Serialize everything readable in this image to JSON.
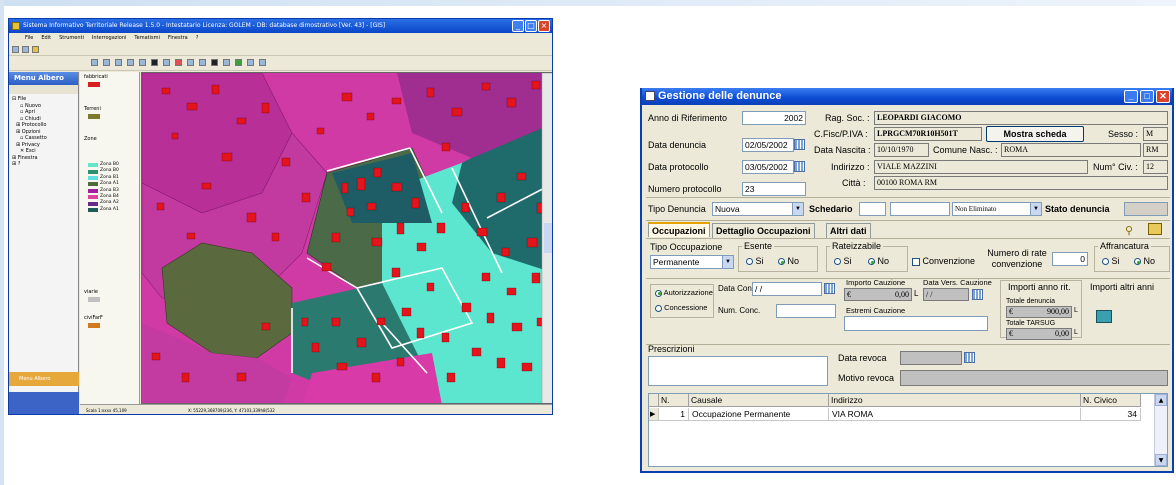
{
  "gis_window": {
    "title": "Sistema Informativo Territoriale Release 1.5.0 - Intestatario Licenza: GOLEM - DB: database dimostrativo [Ver. 43] - [GIS]",
    "menu": [
      "File",
      "Edit",
      "Strumenti",
      "Interrogazioni",
      "Tematismi",
      "Finestra",
      "?"
    ],
    "sidebar_title": "Menu Albero",
    "tree": [
      "File",
      "Nuovo",
      "Apri",
      "Chiudi",
      "Protocollo",
      "Opzioni",
      "Cassetto",
      "Privacy",
      "Esci",
      "Finestra",
      "?"
    ],
    "sidebar_footer": "Menu Albero",
    "layers": [
      {
        "name": "fabbricati",
        "color": "#d62020"
      },
      {
        "name": "Terreni",
        "color": "#7e7a2b"
      },
      {
        "name": "Zone",
        "color": "#f0f0f0"
      },
      {
        "name": "viarie",
        "color": "#c0c0c0"
      },
      {
        "name": "civiFarF",
        "color": "#d07a20"
      }
    ],
    "zones": [
      {
        "name": "Zona B0",
        "color": "#66e6c8"
      },
      {
        "name": "Zona B0",
        "color": "#2e8f6c"
      },
      {
        "name": "Zona B1",
        "color": "#60e0e0"
      },
      {
        "name": "Zona A1",
        "color": "#4d6a3a"
      },
      {
        "name": "Zona B3",
        "color": "#a020a0"
      },
      {
        "name": "Zona B4",
        "color": "#e040a0"
      },
      {
        "name": "Zona A2",
        "color": "#6a2a8a"
      },
      {
        "name": "Zona A1",
        "color": "#1d5c5a"
      }
    ],
    "status": [
      "Scala 1:xxxx 45,109",
      "X: 55229,368709(236, Y: 47103,339h8(532"
    ]
  },
  "gestione": {
    "title": "Gestione delle denunce",
    "labels": {
      "anno": "Anno di Riferimento",
      "data_denuncia": "Data denuncia",
      "data_protocollo": "Data protocollo",
      "numero_protocollo": "Numero protocollo",
      "rag_soc": "Rag. Soc. :",
      "cfisc": "C.Fisc/P.IVA :",
      "data_nascita": "Data Nascita :",
      "comune_nasc": "Comune Nasc. :",
      "indirizzo": "Indirizzo :",
      "citta": "Città :",
      "sesso": "Sesso :",
      "num_civ": "Num° Civ. :",
      "tipo_denuncia": "Tipo Denuncia",
      "schedario": "Schedario",
      "stato_denuncia": "Stato denuncia"
    },
    "values": {
      "anno": "2002",
      "data_denuncia": "02/05/2002",
      "data_protocollo": "03/05/2002",
      "numero_protocollo": "23",
      "rag_soc": "LEOPARDI GIACOMO",
      "cfisc": "LPRGCM70R10H501T",
      "data_nascita": "10/10/1970",
      "comune_nasc": "ROMA",
      "prov": "RM",
      "indirizzo": "VIALE MAZZINI",
      "citta": "00100 ROMA RM",
      "sesso": "M",
      "num_civ": "12",
      "tipo_denuncia": "Nuova",
      "schedario_a": "",
      "schedario_b": "",
      "schedario_c": "Non Eliminato"
    },
    "mostra_scheda": "Mostra scheda",
    "tabs": [
      "Occupazioni",
      "Dettaglio Occupazioni",
      "Altri dati"
    ],
    "occupazioni": {
      "tipo_label": "Tipo Occupazione",
      "tipo_value": "Permanente",
      "esente_label": "Esente",
      "rateizzabile_label": "Rateizzabile",
      "si": "Si",
      "no": "No",
      "convenzione": "Convenzione",
      "numero_rate_label": "Numero di rate convenzione",
      "numero_rate_value": "0",
      "affrancatura_label": "Affrancatura",
      "autorizzazione": "Autorizzazione",
      "concessione": "Concessione",
      "data_conc_label": "Data Conc.",
      "data_conc_value": "/ /",
      "num_conc_label": "Num. Conc.",
      "importo_cauzione_label": "Importo Cauzione",
      "importo_cauzione_value": "0,00",
      "data_vers_label": "Data Vers. Cauzione",
      "data_vers_value": "/ /",
      "estremi_label": "Estremi Cauzione",
      "importi_rit_label": "Importi anno rit.",
      "importi_altri_label": "Importi altri anni",
      "totale_denuncia_label": "Totale denuncia",
      "totale_denuncia_value": "900,00",
      "totale_tarsug_label": "Totale TARSUG",
      "totale_tarsug_value": "0,00",
      "euro": "€",
      "L": "L"
    },
    "prescrizioni_label": "Prescrizioni",
    "data_revoca_label": "Data revoca",
    "motivo_revoca_label": "Motivo revoca",
    "grid": {
      "headers": [
        "N.",
        "Causale",
        "Indirizzo",
        "N. Civico"
      ],
      "rows": [
        {
          "n": "1",
          "causale": "Occupazione Permanente",
          "indirizzo": "VIA ROMA",
          "civico": "34"
        }
      ]
    }
  }
}
